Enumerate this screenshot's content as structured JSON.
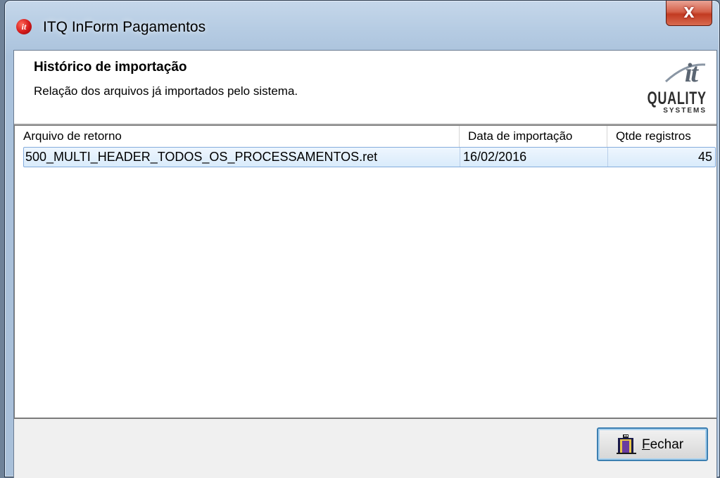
{
  "window": {
    "title": "ITQ InForm Pagamentos",
    "close_label": "X",
    "app_icon_letter": "it"
  },
  "header": {
    "title": "Histórico de importação",
    "subtitle": "Relação dos arquivos já importados pelo sistema."
  },
  "logo": {
    "it": "it",
    "quality": "QUALITY",
    "systems": "SYSTEMS"
  },
  "table": {
    "columns": [
      "Arquivo de retorno",
      "Data de importação",
      "Qtde registros"
    ],
    "rows": [
      {
        "arquivo": "500_MULTI_HEADER_TODOS_OS_PROCESSAMENTOS.ret",
        "data": "16/02/2016",
        "qtde": "45"
      }
    ]
  },
  "footer": {
    "close_button": {
      "mnemonic": "F",
      "rest": "echar"
    }
  },
  "icons": {
    "app": "itq-app-icon",
    "close": "close-icon",
    "fechar": "door-exit-icon"
  },
  "colors": {
    "selection_fill": "#d9ebfb",
    "selection_border": "#84acdd",
    "close_button": "#c23a21",
    "focus_border": "#3c7fb1"
  }
}
